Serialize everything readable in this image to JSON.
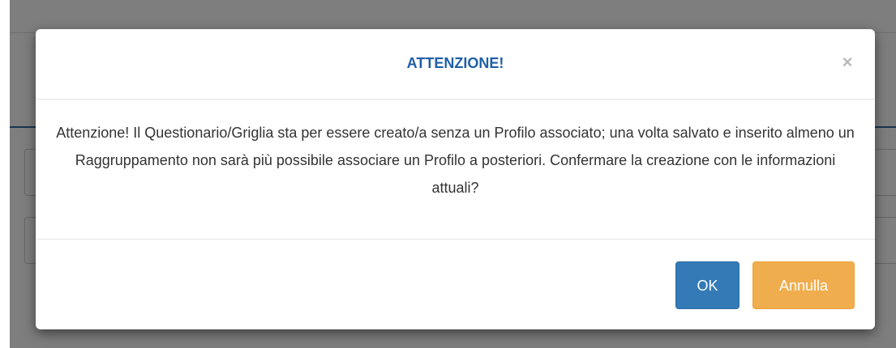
{
  "dialog": {
    "title": "ATTENZIONE!",
    "close_symbol": "×",
    "message": "Attenzione! Il Questionario/Griglia sta per essere creato/a senza un Profilo associato; una volta salvato e inserito almeno un Raggruppamento non sarà più possibile associare un Profilo a posteriori. Confermare la creazione con le informazioni attuali?",
    "buttons": {
      "ok_label": "OK",
      "cancel_label": "Annulla"
    }
  },
  "colors": {
    "title": "#1f5fa8",
    "ok_button": "#337ab7",
    "cancel_button": "#f0ad4e",
    "close_icon": "#b8b8b8"
  },
  "icons": {
    "close": "close-icon"
  }
}
